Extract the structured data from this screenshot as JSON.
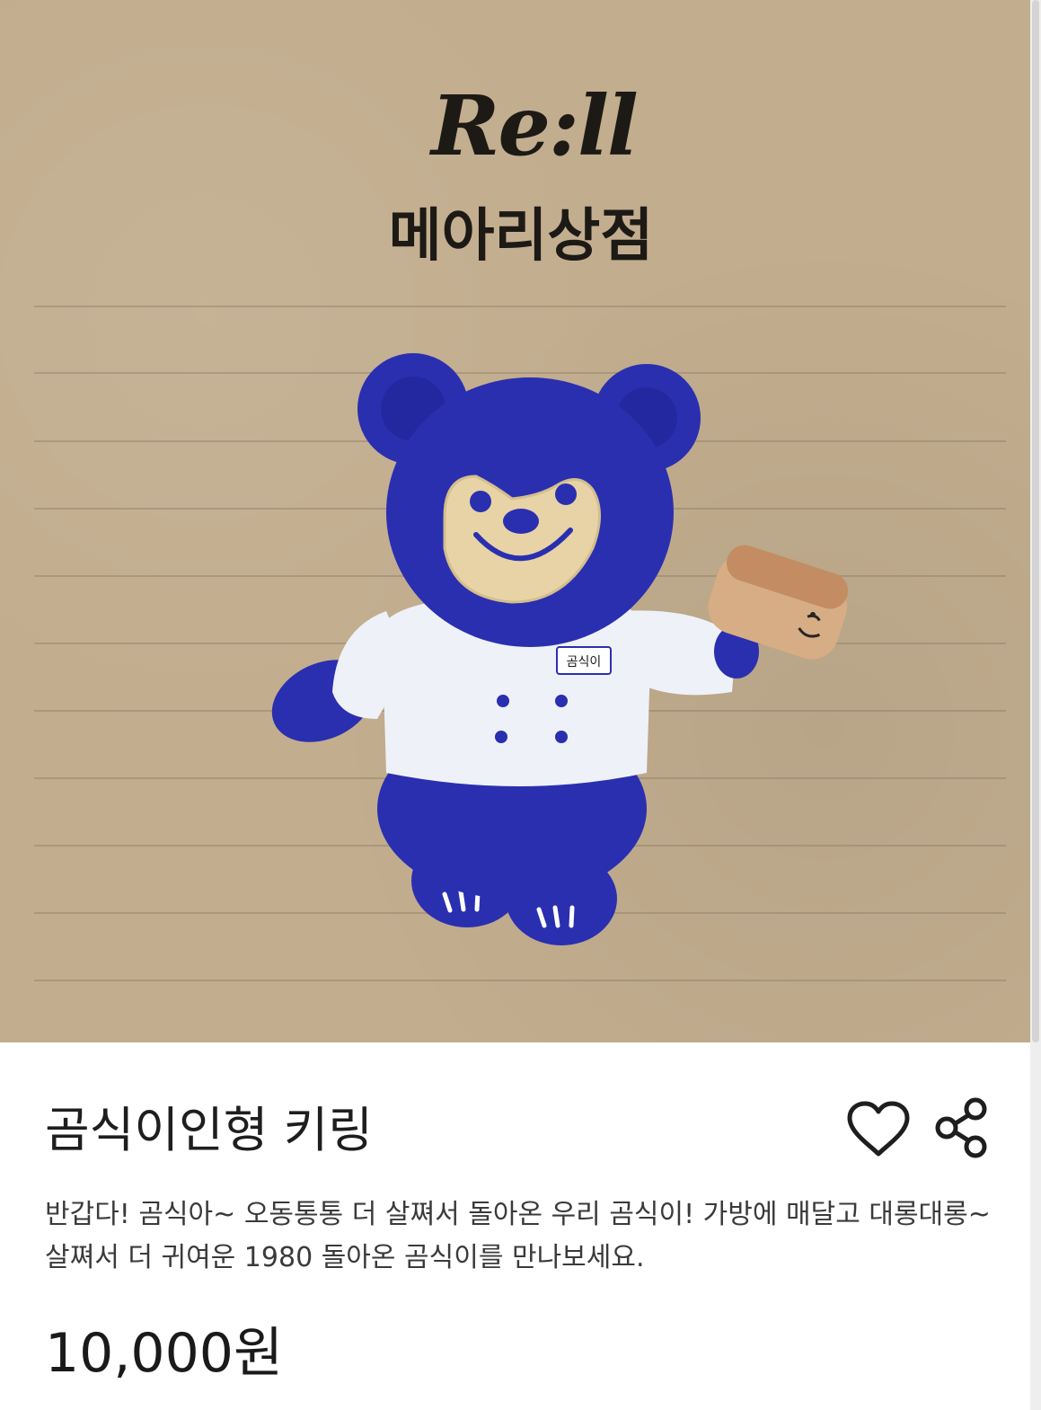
{
  "hero": {
    "brand_logo": "Re:ll",
    "shop_name": "메아리상점",
    "badge_text": "곰식이"
  },
  "product": {
    "title": "곰식이인형 키링",
    "description": "반갑다! 곰식아~ 오동통통 더 살쪄서 돌아온 우리 곰식이! 가방에 매달고 대롱대롱~ 살쪄서 더 귀여운 1980 돌아온 곰식이를 만나보세요.",
    "price": "10,000원"
  },
  "actions": {
    "like_icon": "heart-outline-icon",
    "share_icon": "share-icon"
  },
  "colors": {
    "kraft_background": "#c2ad8e",
    "bear_blue": "#2a2fb0",
    "text_primary": "#1e1e1e"
  }
}
